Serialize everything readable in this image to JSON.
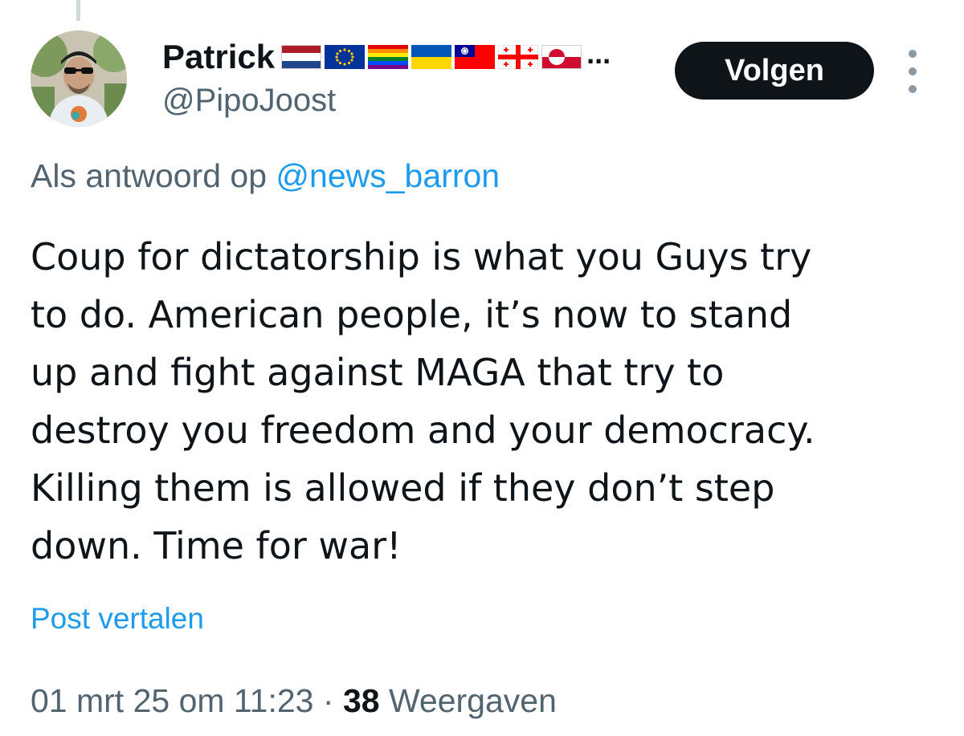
{
  "author": {
    "name": "Patrick",
    "flag_icons": [
      "netherlands-flag-icon",
      "eu-flag-icon",
      "rainbow-flag-icon",
      "ukraine-flag-icon",
      "taiwan-flag-icon",
      "georgia-flag-icon",
      "greenland-flag-icon"
    ],
    "name_overflow": "...",
    "handle": "@PipoJoost"
  },
  "follow_button": {
    "label": "Volgen"
  },
  "reply": {
    "prefix": "Als antwoord op",
    "mention": "@news_barron"
  },
  "post": {
    "lines": [
      "Coup for dictatorship is what you Guys try",
      "to do. American people, it’s now to stand",
      "up and fight against MAGA that try to",
      "destroy you freedom and your democracy.",
      "Killing them is allowed if they don’t step",
      "down. Time for war!"
    ]
  },
  "translate_link": "Post vertalen",
  "meta": {
    "datetime": "01 mrt 25 om 11:23",
    "separator": "·",
    "views_count": "38",
    "views_label": "Weergaven"
  },
  "colors": {
    "text": "#0f1419",
    "secondary": "#536471",
    "link": "#1d9bf0",
    "button_bg": "#0f1419"
  }
}
